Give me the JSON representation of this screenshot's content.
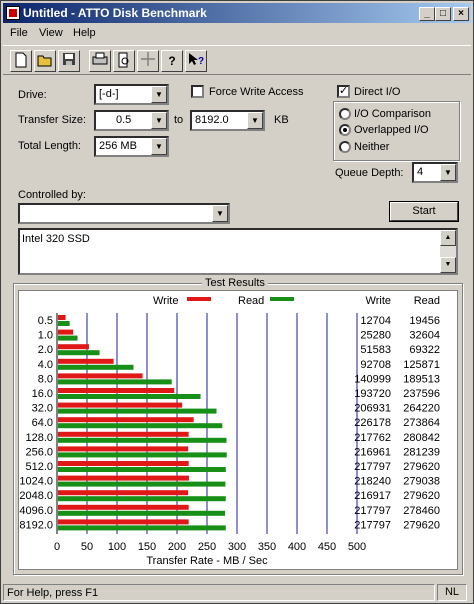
{
  "window": {
    "title": "Untitled - ATTO Disk Benchmark",
    "min_glyph": "_",
    "max_glyph": "□",
    "close_glyph": "×"
  },
  "menu": [
    "File",
    "View",
    "Help"
  ],
  "toolbar": [
    "new-icon",
    "open-icon",
    "save-icon",
    "print-icon",
    "print-preview-icon",
    "move-icon",
    "help-icon",
    "context-help-icon"
  ],
  "form": {
    "drive_label": "Drive:",
    "drive_value": "[-d-]",
    "transfer_size_label": "Transfer Size:",
    "transfer_from": "0.5",
    "to_label": "to",
    "transfer_to": "8192.0",
    "kb_label": "KB",
    "total_length_label": "Total Length:",
    "total_length": "256 MB",
    "force_write_label": "Force Write Access",
    "force_write": false,
    "direct_io_label": "Direct I/O",
    "direct_io": true,
    "io_options": [
      {
        "label": "I/O Comparison",
        "selected": false
      },
      {
        "label": "Overlapped I/O",
        "selected": true
      },
      {
        "label": "Neither",
        "selected": false
      }
    ],
    "queue_depth_label": "Queue Depth:",
    "queue_depth": "4",
    "controlled_by_label": "Controlled by:",
    "controlled_by": "",
    "start_label": "Start",
    "description": "Intel 320 SSD"
  },
  "chart_data": {
    "type": "bar",
    "title": "Test Results",
    "xlabel": "Transfer Rate - MB / Sec",
    "xlim": [
      0,
      500
    ],
    "xticks": [
      "0",
      "50",
      "100",
      "150",
      "200",
      "250",
      "300",
      "350",
      "400",
      "450",
      "500"
    ],
    "categories": [
      "0.5",
      "1.0",
      "2.0",
      "4.0",
      "8.0",
      "16.0",
      "32.0",
      "64.0",
      "128.0",
      "256.0",
      "512.0",
      "1024.0",
      "2048.0",
      "4096.0",
      "8192.0"
    ],
    "series": [
      {
        "name": "Write",
        "color": "#e01818",
        "values": [
          12704,
          25280,
          51583,
          92708,
          140999,
          193720,
          206931,
          226178,
          217762,
          216961,
          217797,
          218240,
          216917,
          217797,
          217797
        ]
      },
      {
        "name": "Read",
        "color": "#189018",
        "values": [
          19456,
          32604,
          69322,
          125871,
          189513,
          237596,
          264220,
          273864,
          280842,
          281239,
          279620,
          279038,
          279620,
          278460,
          279620
        ]
      }
    ],
    "value_unit_divisor": 1000,
    "col_headers": [
      "Write",
      "Read"
    ]
  },
  "status": {
    "text": "For Help, press F1",
    "nl": "NL"
  }
}
